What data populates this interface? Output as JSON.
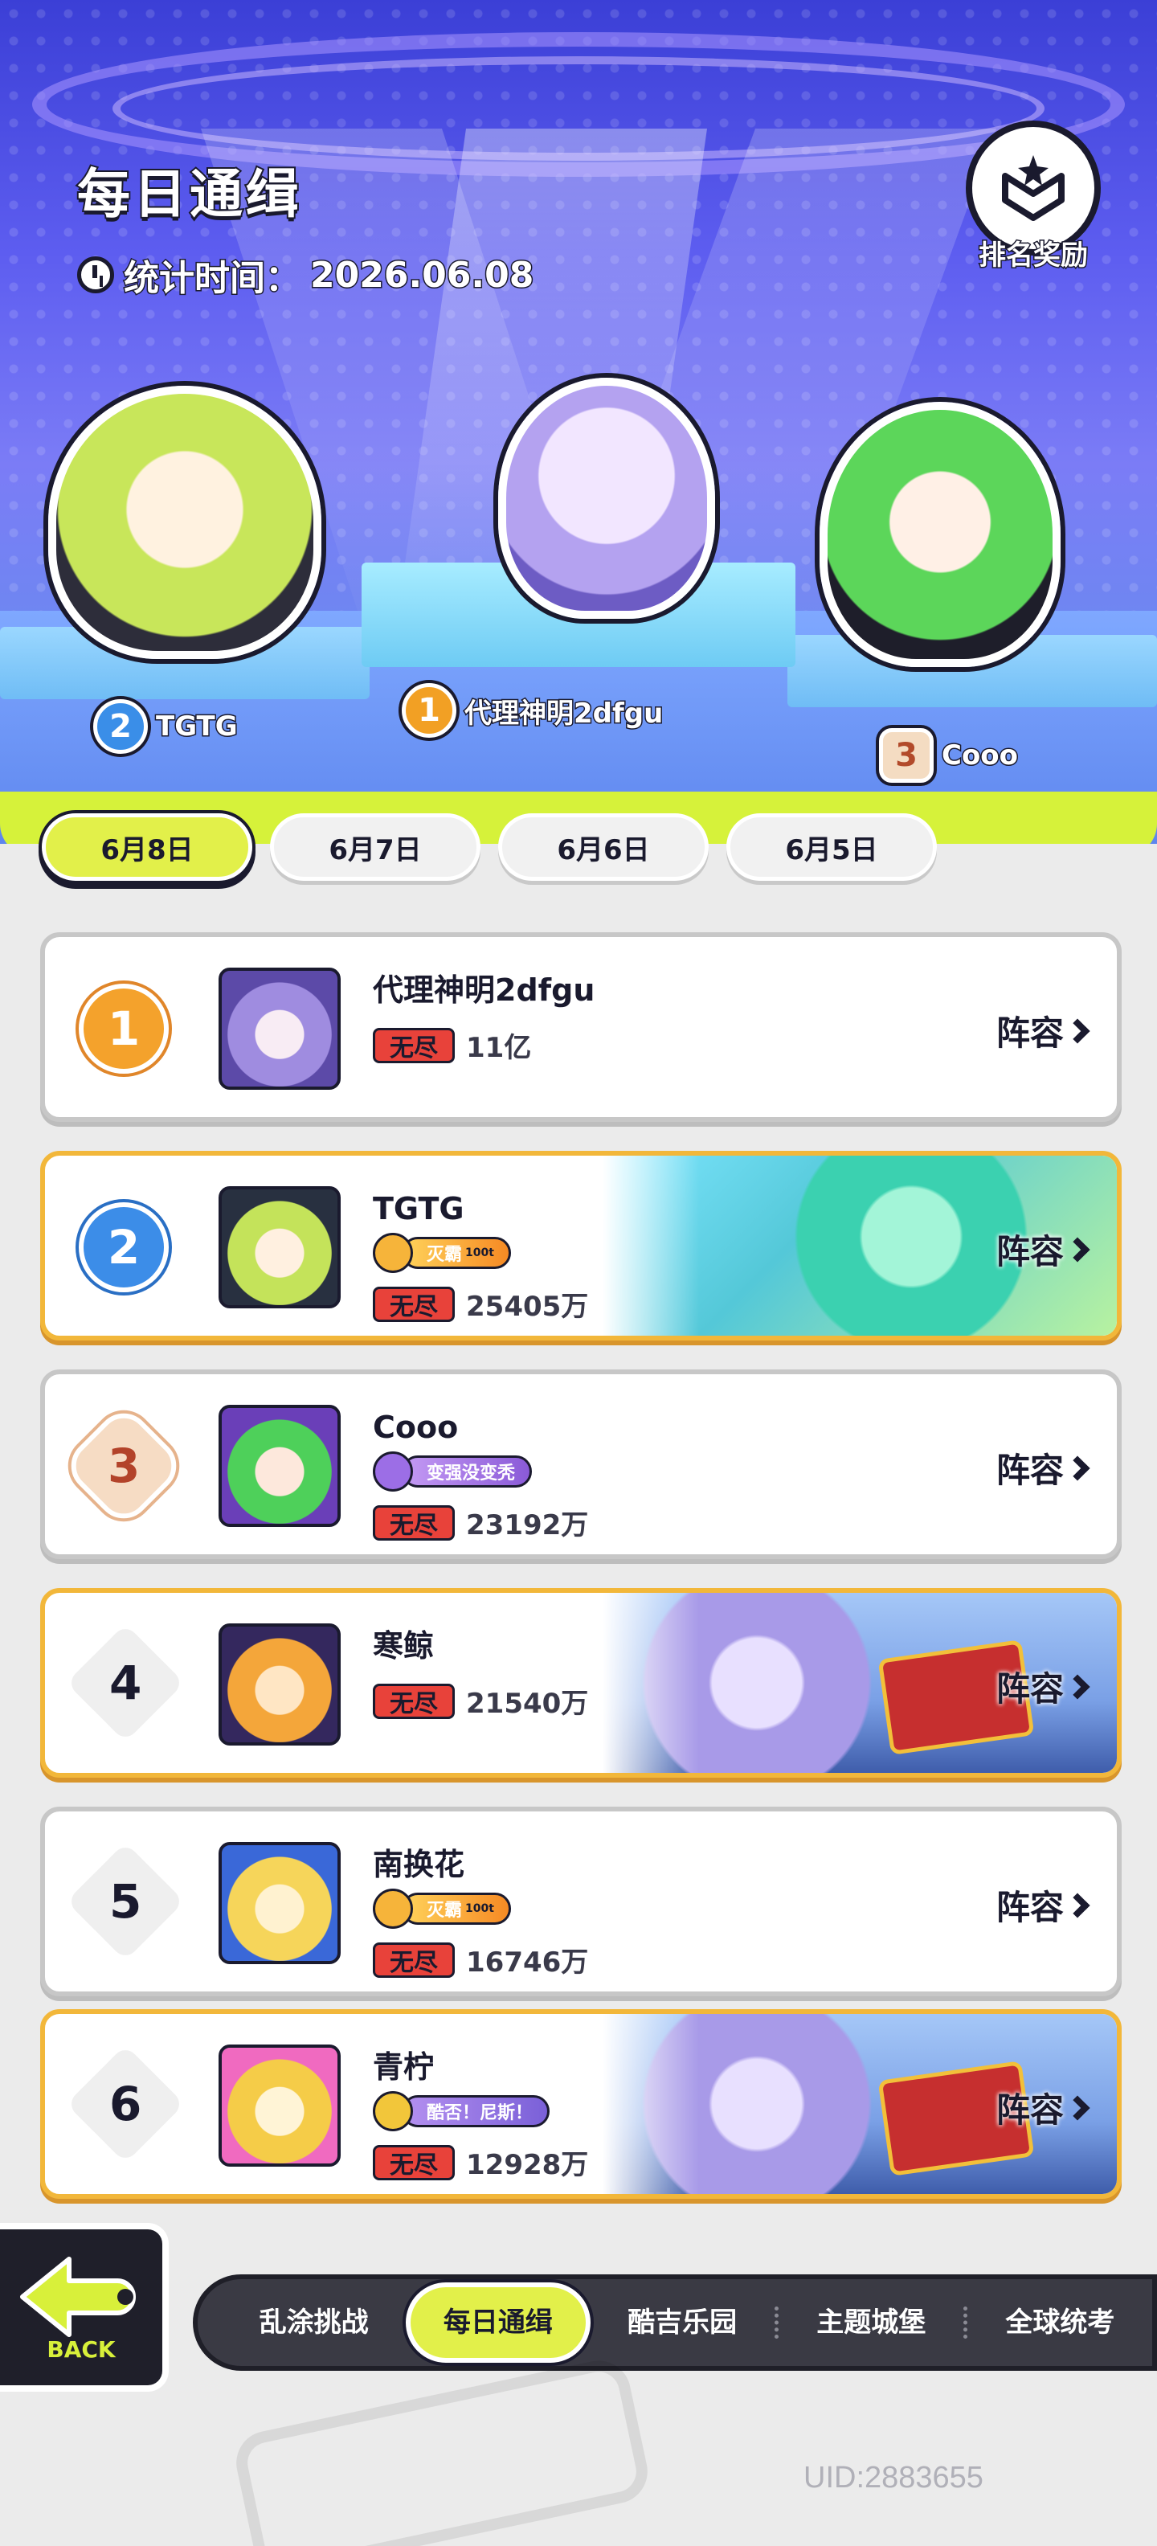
{
  "header": {
    "title": "每日通缉",
    "stat_label": "统计时间：",
    "stat_date": "2026.06.08",
    "reward_label": "排名奖励"
  },
  "podium": [
    {
      "rank": "2",
      "name": "TGTG"
    },
    {
      "rank": "1",
      "name": "代理神明2dfgu"
    },
    {
      "rank": "3",
      "name": "Cooo"
    }
  ],
  "date_tabs": [
    {
      "label": "6月8日",
      "active": true
    },
    {
      "label": "6月7日",
      "active": false
    },
    {
      "label": "6月6日",
      "active": false
    },
    {
      "label": "6月5日",
      "active": false
    }
  ],
  "rows": [
    {
      "rank": "1",
      "name": "代理神明2dfgu",
      "title": "",
      "mode": "无尽",
      "score": "11亿",
      "action": "阵容"
    },
    {
      "rank": "2",
      "name": "TGTG",
      "title": "灭霸",
      "title_sup": "100t",
      "mode": "无尽",
      "score": "25405万",
      "action": "阵容"
    },
    {
      "rank": "3",
      "name": "Cooo",
      "title": "变强没变秃",
      "mode": "无尽",
      "score": "23192万",
      "action": "阵容"
    },
    {
      "rank": "4",
      "name": "寒鲸",
      "title": "",
      "mode": "无尽",
      "score": "21540万",
      "action": "阵容"
    },
    {
      "rank": "5",
      "name": "南换花",
      "title": "灭霸",
      "title_sup": "100t",
      "mode": "无尽",
      "score": "16746万",
      "action": "阵容"
    },
    {
      "rank": "6",
      "name": "青柠",
      "title": "酷否！尼斯！",
      "mode": "无尽",
      "score": "12928万",
      "action": "阵容"
    }
  ],
  "back": {
    "label": "BACK"
  },
  "nav": [
    {
      "label": "乱涂挑战",
      "active": false
    },
    {
      "label": "每日通缉",
      "active": true
    },
    {
      "label": "酷吉乐园",
      "active": false
    },
    {
      "label": "主题城堡",
      "active": false
    },
    {
      "label": "全球统考",
      "active": false
    }
  ],
  "uid": "UID:2883655",
  "colors": {
    "accent": "#e2f04a",
    "gold_border": "#f2b73a",
    "mode_tag": "#e8423a",
    "dark": "#1a1a2e"
  }
}
